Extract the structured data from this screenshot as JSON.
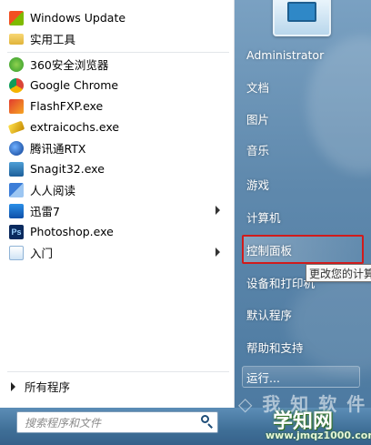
{
  "programs": [
    {
      "label": "Windows Update",
      "icon": "windows-update-icon",
      "submenu": false
    },
    {
      "label": "实用工具",
      "icon": "folder-icon",
      "submenu": false
    },
    {
      "label": "360安全浏览器",
      "icon": "browser-360-icon",
      "submenu": false
    },
    {
      "label": "Google Chrome",
      "icon": "chrome-icon",
      "submenu": false
    },
    {
      "label": "FlashFXP.exe",
      "icon": "flashfxp-icon",
      "submenu": false
    },
    {
      "label": "extraicochs.exe",
      "icon": "extraicochs-icon",
      "submenu": false
    },
    {
      "label": "腾讯通RTX",
      "icon": "rtx-icon",
      "submenu": false
    },
    {
      "label": "Snagit32.exe",
      "icon": "snagit-icon",
      "submenu": false
    },
    {
      "label": "人人阅读",
      "icon": "reader-icon",
      "submenu": false
    },
    {
      "label": "迅雷7",
      "icon": "thunder-icon",
      "submenu": true
    },
    {
      "label": "Photoshop.exe",
      "icon": "photoshop-icon",
      "submenu": false
    },
    {
      "label": "入门",
      "icon": "getting-started-icon",
      "submenu": true
    }
  ],
  "all_programs": "所有程序",
  "search": {
    "placeholder": "搜索程序和文件"
  },
  "right_menu": {
    "user": "Administrator",
    "documents": "文档",
    "pictures": "图片",
    "music": "音乐",
    "games": "游戏",
    "computer": "计算机",
    "control_panel": "控制面板",
    "devices": "设备和打印机",
    "default_programs": "默认程序",
    "help": "帮助和支持",
    "run": "运行..."
  },
  "tooltip": "更改您的计算",
  "watermark": {
    "logo": "◇ 我 知 软 件",
    "site": "学知网",
    "url": "www.jmqz1000.com"
  },
  "colors": {
    "highlight_border": "#d11b1b",
    "pane_blue": "#5f89ad"
  }
}
